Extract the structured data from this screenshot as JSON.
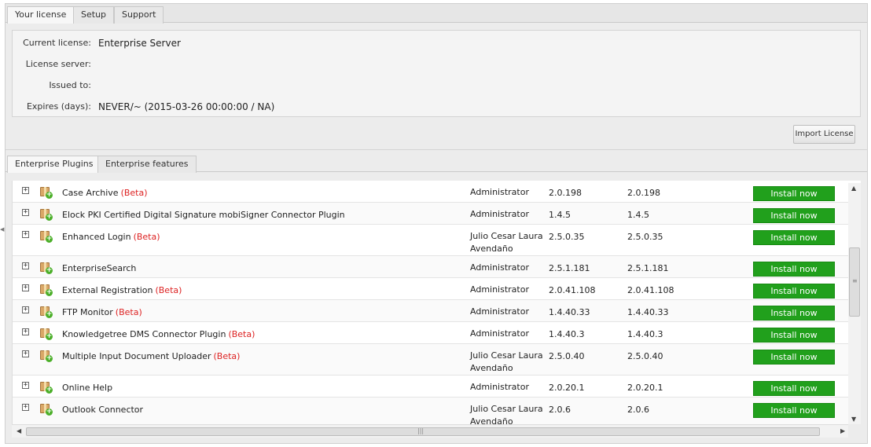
{
  "top_tabs": [
    "Your license",
    "Setup",
    "Support"
  ],
  "license": {
    "current_label": "Current license:",
    "current_value": "Enterprise Server",
    "server_label": "License server:",
    "server_value": "",
    "issued_label": "Issued to:",
    "issued_value": "",
    "expires_label": "Expires (days):",
    "expires_value": "NEVER/~ (2015-03-26 00:00:00 / NA)"
  },
  "import_button": "Import License",
  "lower_tabs": [
    "Enterprise Plugins",
    "Enterprise features"
  ],
  "expander_glyph": "+",
  "install_label": "Install now",
  "beta_label": "(Beta)",
  "colors": {
    "install_green": "#21a01c",
    "beta_red": "#d22222"
  },
  "plugins": [
    {
      "name": "Case Archive",
      "beta": true,
      "author": "Administrator",
      "author2": "",
      "v1": "2.0.198",
      "v2": "2.0.198"
    },
    {
      "name": "Elock PKI Certified Digital Signature mobiSigner Connector Plugin",
      "beta": false,
      "author": "Administrator",
      "author2": "",
      "v1": "1.4.5",
      "v2": "1.4.5"
    },
    {
      "name": "Enhanced Login",
      "beta": true,
      "author": "Julio Cesar Laura",
      "author2": "Avendaño",
      "v1": "2.5.0.35",
      "v2": "2.5.0.35"
    },
    {
      "name": "EnterpriseSearch",
      "beta": false,
      "author": "Administrator",
      "author2": "",
      "v1": "2.5.1.181",
      "v2": "2.5.1.181"
    },
    {
      "name": "External Registration",
      "beta": true,
      "author": "Administrator",
      "author2": "",
      "v1": "2.0.41.108",
      "v2": "2.0.41.108"
    },
    {
      "name": "FTP Monitor",
      "beta": true,
      "author": "Administrator",
      "author2": "",
      "v1": "1.4.40.33",
      "v2": "1.4.40.33"
    },
    {
      "name": "Knowledgetree DMS Connector Plugin",
      "beta": true,
      "author": "Administrator",
      "author2": "",
      "v1": "1.4.40.3",
      "v2": "1.4.40.3"
    },
    {
      "name": "Multiple Input Document Uploader",
      "beta": true,
      "author": "Julio Cesar Laura",
      "author2": "Avendaño",
      "v1": "2.5.0.40",
      "v2": "2.5.0.40"
    },
    {
      "name": "Online Help",
      "beta": false,
      "author": "Administrator",
      "author2": "",
      "v1": "2.0.20.1",
      "v2": "2.0.20.1"
    },
    {
      "name": "Outlook Connector",
      "beta": false,
      "author": "Julio Cesar Laura",
      "author2": "Avendaño",
      "v1": "2.0.6",
      "v2": "2.0.6"
    }
  ]
}
